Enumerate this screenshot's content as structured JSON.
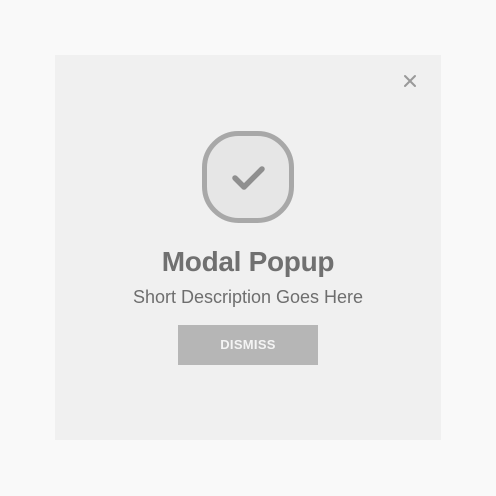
{
  "modal": {
    "title": "Modal Popup",
    "description": "Short Description Goes Here",
    "dismiss_label": "DISMISS",
    "close_icon": "close-icon",
    "status_icon": "check-icon"
  },
  "colors": {
    "page_background": "#f9f9f9",
    "modal_background": "#f0f0f0",
    "icon": "#a8a8a8",
    "button": "#b6b6b6",
    "title": "#707070"
  }
}
